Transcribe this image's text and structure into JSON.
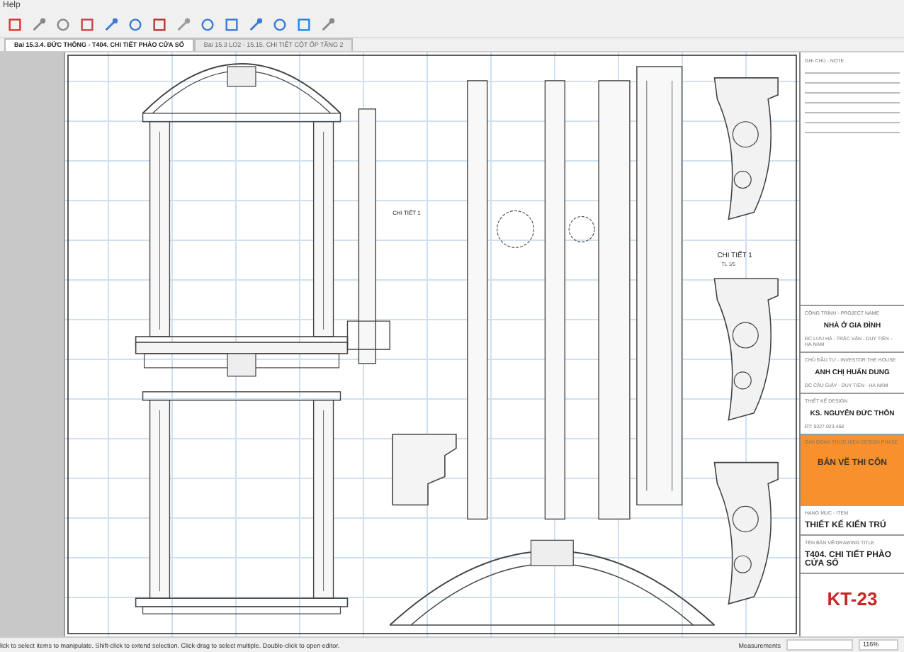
{
  "menu": {
    "label": "Help"
  },
  "tabs": [
    {
      "label": "Bai 15.3.4. ĐỨC THÔNG - T404. CHI TIẾT PHÀO CỬA SỔ",
      "selected": true
    },
    {
      "label": "Bai 15.3 LO2 - 15.15. CHI TIẾT CỘT ỐP TẦNG 2",
      "selected": false
    }
  ],
  "drawing": {
    "labels": [
      "CHI TIẾT 1",
      "CHI TIẾT 1",
      "TL 1/5"
    ]
  },
  "title_block": {
    "note_label": "GHI CHÚ - NOTE",
    "sections": [
      {
        "label": "CÔNG TRÌNH - PROJECT NAME",
        "value": "NHÀ Ở GIA ĐÌNH",
        "sub": "ĐC LƯU HÀ - TRẮC VĂN - DUY TIÊN - HÀ NAM"
      },
      {
        "label": "CHỦ ĐẦU TƯ - INVESTOR THE HOUSE",
        "value": "ANH CHỊ HUẤN DUNG",
        "sub": "ĐC CẦU GIẤY - DUY TIÊN - HÀ NAM"
      },
      {
        "label": "THIẾT KẾ DESIGN",
        "value": "KS. NGUYỄN ĐỨC THÔN",
        "sub": "ĐT: 0327.023.468"
      }
    ],
    "phase_label": "GIAI ĐOẠN THỰC HIỆN DESIGN PHASE",
    "phase": "BẢN VẼ THI CÔN",
    "item_label": "HẠNG MỤC - ITEM",
    "item": "THIẾT KẾ KIẾN TRÚ",
    "title_label": "TÊN BẢN VẼ/DRAWING TITLE",
    "title": "T404. CHI TIẾT PHÀO CỬA SỔ",
    "sheet": "KT-23"
  },
  "status_bar": {
    "hint": "lick to select items to manipulate. Shift-click to extend selection. Click-drag to select multiple. Double-click to open editor.",
    "measurements_label": "Measurements",
    "zoom": "116%"
  }
}
